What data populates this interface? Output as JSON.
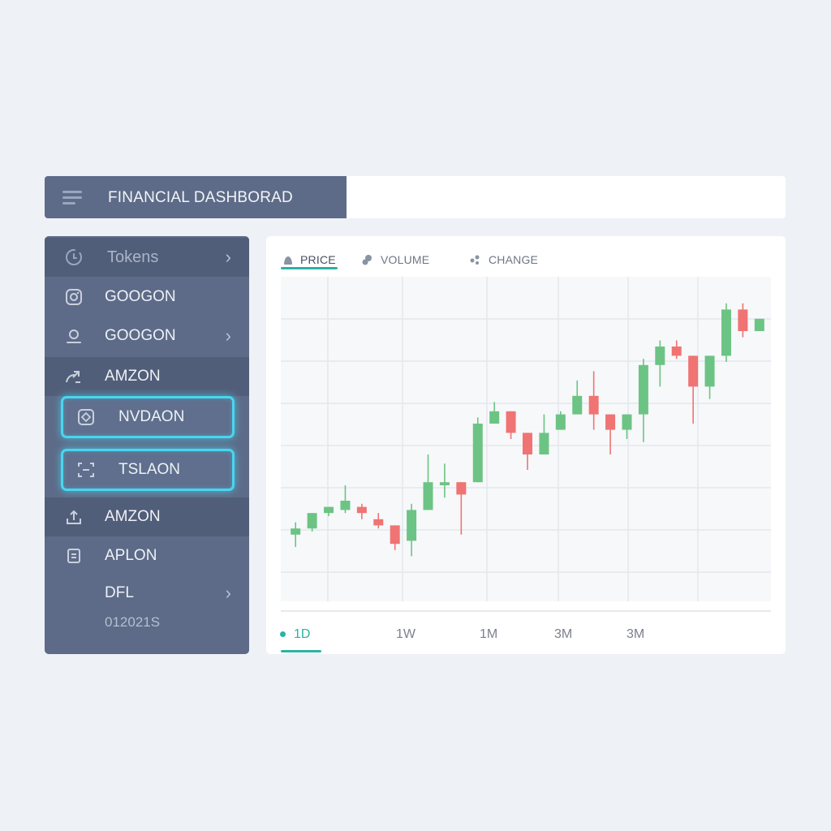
{
  "header": {
    "title": "FINANCIAL DASHBORAD",
    "menu_icon": "hamburger-menu-icon"
  },
  "sidebar": {
    "items": [
      {
        "label": "Tokens",
        "icon": "clock-icon",
        "chevron": "›"
      },
      {
        "label": "GOOGON",
        "icon": "camera-icon"
      },
      {
        "label": "GOOGON",
        "icon": "user-icon",
        "chevron": "›"
      },
      {
        "label": "AMZON",
        "icon": "trend-icon"
      },
      {
        "label": "NVDAON",
        "icon": "chip-icon"
      },
      {
        "label": "TSLAON",
        "icon": "scan-icon"
      },
      {
        "label": "AMZON",
        "icon": "upload-icon"
      },
      {
        "label": "APLON",
        "icon": "box-icon"
      },
      {
        "label": "DFL",
        "chevron": "›"
      }
    ],
    "sub_label": "012021S"
  },
  "tabs": [
    {
      "label": "PRICE",
      "icon": "bell-shape-icon"
    },
    {
      "label": "VOLUME",
      "icon": "cluster-icon"
    },
    {
      "label": "CHANGE",
      "icon": "dots-icon"
    }
  ],
  "ranges": [
    "1D",
    "1W",
    "1M",
    "3M",
    "3M"
  ],
  "colors": {
    "up": "#6cc484",
    "down": "#ef7473",
    "accent": "#2bb3a3",
    "highlight": "#48d6f0"
  },
  "chart_data": {
    "type": "candlestick",
    "ylim": [
      0,
      100
    ],
    "grid": true,
    "candles": [
      {
        "o": 19,
        "c": 21,
        "h": 23,
        "l": 15
      },
      {
        "o": 21,
        "c": 26,
        "h": 26,
        "l": 20
      },
      {
        "o": 26,
        "c": 28,
        "h": 28,
        "l": 25
      },
      {
        "o": 27,
        "c": 30,
        "h": 35,
        "l": 26
      },
      {
        "o": 28,
        "c": 26,
        "h": 29,
        "l": 24
      },
      {
        "o": 24,
        "c": 22,
        "h": 26,
        "l": 21
      },
      {
        "o": 22,
        "c": 16,
        "h": 22,
        "l": 14
      },
      {
        "o": 17,
        "c": 27,
        "h": 29,
        "l": 12
      },
      {
        "o": 27,
        "c": 36,
        "h": 45,
        "l": 27
      },
      {
        "o": 35,
        "c": 36,
        "h": 42,
        "l": 31
      },
      {
        "o": 36,
        "c": 32,
        "h": 36,
        "l": 19
      },
      {
        "o": 36,
        "c": 55,
        "h": 57,
        "l": 36
      },
      {
        "o": 55,
        "c": 59,
        "h": 62,
        "l": 55
      },
      {
        "o": 59,
        "c": 52,
        "h": 59,
        "l": 50
      },
      {
        "o": 52,
        "c": 45,
        "h": 52,
        "l": 40
      },
      {
        "o": 45,
        "c": 52,
        "h": 58,
        "l": 45
      },
      {
        "o": 53,
        "c": 58,
        "h": 59,
        "l": 53
      },
      {
        "o": 58,
        "c": 64,
        "h": 69,
        "l": 58
      },
      {
        "o": 64,
        "c": 58,
        "h": 72,
        "l": 53
      },
      {
        "o": 58,
        "c": 53,
        "h": 58,
        "l": 45
      },
      {
        "o": 53,
        "c": 58,
        "h": 58,
        "l": 50
      },
      {
        "o": 58,
        "c": 74,
        "h": 76,
        "l": 49
      },
      {
        "o": 74,
        "c": 80,
        "h": 82,
        "l": 67
      },
      {
        "o": 80,
        "c": 77,
        "h": 82,
        "l": 76
      },
      {
        "o": 77,
        "c": 67,
        "h": 77,
        "l": 55
      },
      {
        "o": 67,
        "c": 77,
        "h": 77,
        "l": 63
      },
      {
        "o": 77,
        "c": 92,
        "h": 94,
        "l": 75
      },
      {
        "o": 92,
        "c": 85,
        "h": 94,
        "l": 83
      },
      {
        "o": 85,
        "c": 89,
        "h": 89,
        "l": 85
      }
    ]
  }
}
